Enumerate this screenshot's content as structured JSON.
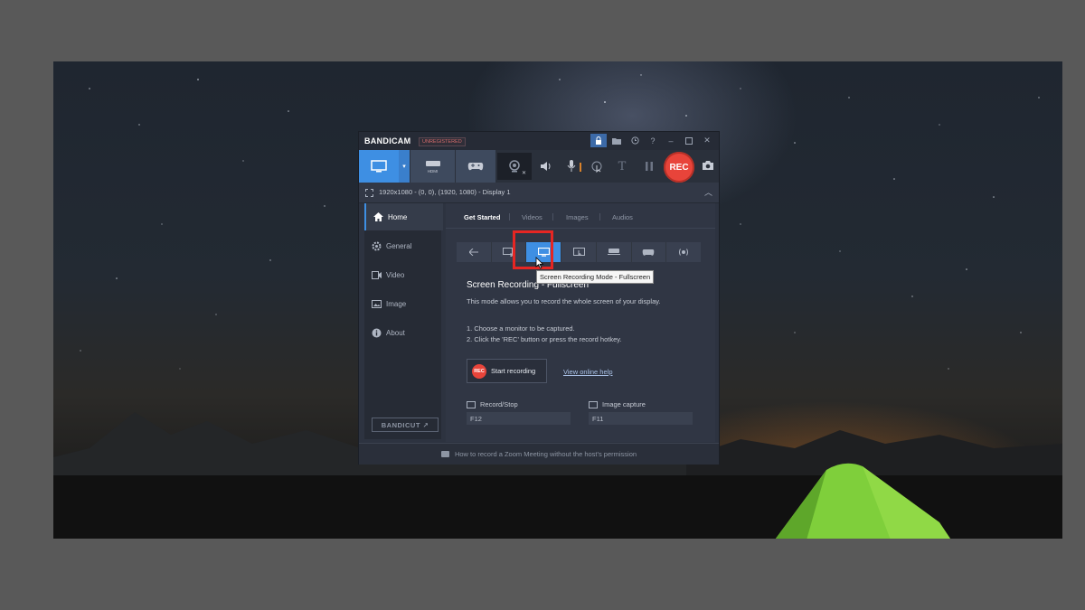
{
  "window": {
    "brand": "BANDICAM",
    "registration": "UNREGISTERED"
  },
  "toolbar": {
    "rec_label": "REC",
    "hdmi_label": "HDMI"
  },
  "infobar": {
    "region_text": "1920x1080 - (0, 0), (1920, 1080) - Display 1"
  },
  "sidebar": {
    "items": [
      {
        "label": "Home",
        "icon": "home-icon"
      },
      {
        "label": "General",
        "icon": "gear-icon"
      },
      {
        "label": "Video",
        "icon": "video-icon"
      },
      {
        "label": "Image",
        "icon": "image-icon"
      },
      {
        "label": "About",
        "icon": "info-icon"
      }
    ],
    "bandicut_label": "BANDICUT ↗"
  },
  "tabs": [
    "Get Started",
    "Videos",
    "Images",
    "Audios"
  ],
  "content": {
    "tooltip": "Screen Recording Mode - Fullscreen",
    "title": "Screen Recording - Fullscreen",
    "description": "This mode allows you to record the whole screen of your display.",
    "step1": "1. Choose a monitor to be captured.",
    "step2": "2. Click the 'REC' button or press the record hotkey.",
    "start_button": "Start recording",
    "start_button_icon_text": "REC",
    "help_link": "View online help",
    "hotkeys": {
      "record_label": "Record/Stop",
      "record_value": "F12",
      "image_label": "Image capture",
      "image_value": "F11"
    }
  },
  "statusbar": {
    "text": "How to record a Zoom Meeting without the host's permission"
  },
  "colors": {
    "accent": "#3e8fe3",
    "rec": "#e8443a",
    "highlight": "#e52623"
  }
}
